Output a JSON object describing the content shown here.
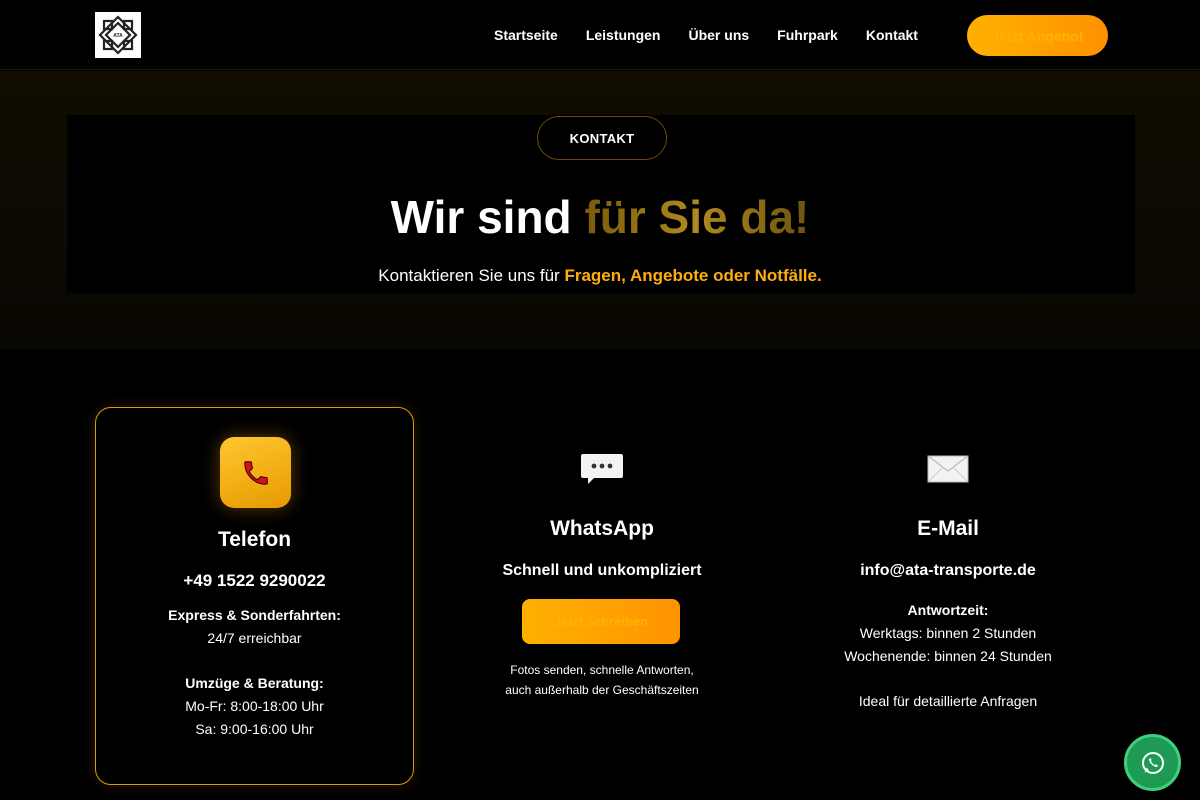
{
  "header": {
    "logo_icon": "company-logo-emblem",
    "nav": [
      "Startseite",
      "Leistungen",
      "Über uns",
      "Fuhrpark",
      "Kontakt"
    ],
    "cta_label": "Jetzt Angebot"
  },
  "hero": {
    "badge": "KONTAKT",
    "title_part1": "Wir sind",
    "title_part2": "für Sie da!",
    "subtitle_part1": "Kontaktieren Sie uns für",
    "subtitle_highlight": "Fragen, Angebote oder Notfälle."
  },
  "cards": {
    "phone": {
      "icon": "telephone-receiver-icon",
      "title": "Telefon",
      "number": "+49 1522 9290022",
      "express_label": "Express & Sonderfahrten:",
      "express_value": "24/7 erreichbar",
      "moving_label": "Umzüge & Beratung:",
      "hours_weekday": "Mo-Fr: 8:00-18:00 Uhr",
      "hours_saturday": "Sa: 9:00-16:00 Uhr"
    },
    "whatsapp": {
      "icon": "speech-bubble-icon",
      "title": "WhatsApp",
      "tagline": "Schnell und unkompliziert",
      "button_label": "Jetzt schreiben",
      "note_line1": "Fotos senden, schnelle Antworten,",
      "note_line2": "auch außerhalb der Geschäftszeiten"
    },
    "email": {
      "icon": "envelope-icon",
      "title": "E-Mail",
      "address": "info@ata-transporte.de",
      "response_label": "Antwortzeit:",
      "response_weekday": "Werktags: binnen 2 Stunden",
      "response_weekend": "Wochenende: binnen 24 Stunden",
      "ideal_note": "Ideal für detaillierte Anfragen"
    }
  },
  "floating": {
    "icon": "whatsapp-icon"
  },
  "colors": {
    "accent": "#ffac10",
    "card_border": "#d99a0b",
    "whatsapp_green": "#1f9a54"
  }
}
